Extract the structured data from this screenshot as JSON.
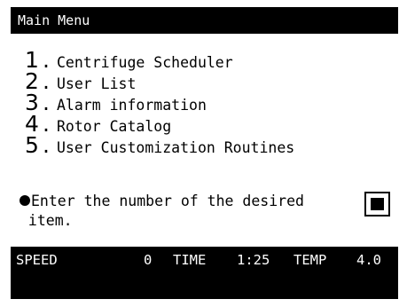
{
  "header": {
    "title": "Main Menu"
  },
  "menu": {
    "items": [
      {
        "number": "1",
        "label": "Centrifuge Scheduler"
      },
      {
        "number": "2",
        "label": "User List"
      },
      {
        "number": "3",
        "label": "Alarm information"
      },
      {
        "number": "4",
        "label": "Rotor Catalog"
      },
      {
        "number": "5",
        "label": "User Customization Routines"
      }
    ]
  },
  "prompt": {
    "line1": "Enter the number of the desired",
    "line2": " item."
  },
  "status": {
    "speed_label": "SPEED",
    "speed_value": "0",
    "time_label": "TIME",
    "time_value": "1:25",
    "temp_label": "TEMP",
    "temp_value": "4.0"
  },
  "colors": {
    "background": "#000000",
    "panel": "#ffffff",
    "text_on_dark": "#ffffff",
    "text_on_light": "#000000"
  }
}
